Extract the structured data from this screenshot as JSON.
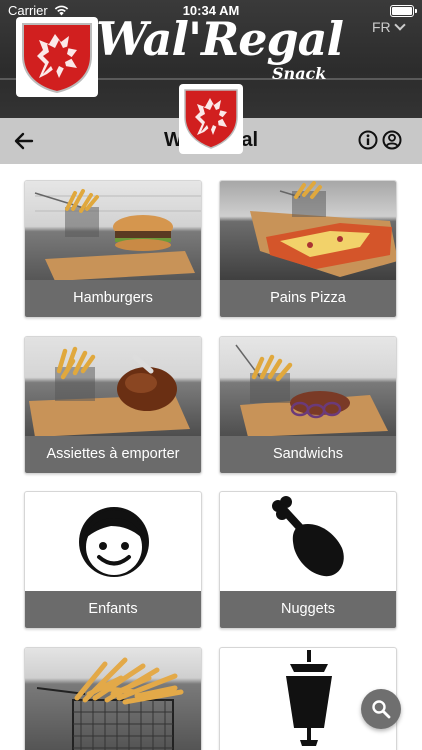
{
  "status_bar": {
    "carrier": "Carrier",
    "time": "10:34 AM"
  },
  "banner": {
    "brand": "Wal'Regal",
    "subtitle": "Snack",
    "language": "FR"
  },
  "navbar": {
    "title": "Wal'Regal"
  },
  "categories": [
    {
      "label": "Hamburgers",
      "icon": "burger-photo"
    },
    {
      "label": "Pains Pizza",
      "icon": "pizza-photo"
    },
    {
      "label": "Assiettes à emporter",
      "icon": "plate-photo"
    },
    {
      "label": "Sandwichs",
      "icon": "sandwich-photo"
    },
    {
      "label": "Enfants",
      "icon": "smiley-face-icon"
    },
    {
      "label": "Nuggets",
      "icon": "drumstick-icon"
    },
    {
      "label": "",
      "icon": "fries-basket-photo"
    },
    {
      "label": "",
      "icon": "kebab-spit-icon"
    }
  ],
  "colors": {
    "banner": "#2f2f2f",
    "navbar": "#c8c8c8",
    "card_label_bg": "#6b6b6b",
    "fab": "#6f6f6f",
    "shield_red": "#d11f1f"
  }
}
